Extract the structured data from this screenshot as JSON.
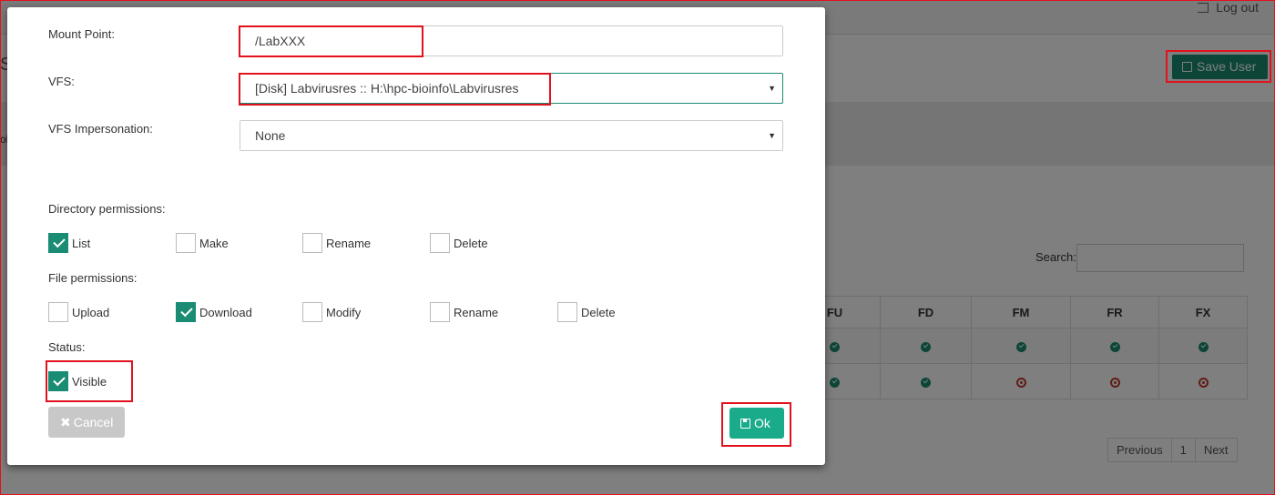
{
  "header": {
    "logout_label": "Log out",
    "save_user_label": "Save User"
  },
  "background": {
    "title_fragment": "S",
    "band_fragment": "ol",
    "search_label": "Search:",
    "table": {
      "columns": [
        "FU",
        "FD",
        "FM",
        "FR",
        "FX"
      ],
      "rows": [
        [
          "ok",
          "ok",
          "ok",
          "ok",
          "ok"
        ],
        [
          "ok",
          "ok",
          "no",
          "no",
          "no"
        ]
      ]
    },
    "pagination": {
      "previous": "Previous",
      "page": "1",
      "next": "Next"
    }
  },
  "modal": {
    "mount_point": {
      "label": "Mount Point:",
      "value": "/LabXXX"
    },
    "vfs": {
      "label": "VFS:",
      "value": "[Disk] Labvirusres :: H:\\hpc-bioinfo\\Labvirusres"
    },
    "vfs_impersonation": {
      "label": "VFS Impersonation:",
      "value": "None"
    },
    "directory_permissions": {
      "label": "Directory permissions:",
      "items": [
        {
          "label": "List",
          "checked": true
        },
        {
          "label": "Make",
          "checked": false
        },
        {
          "label": "Rename",
          "checked": false
        },
        {
          "label": "Delete",
          "checked": false
        }
      ]
    },
    "file_permissions": {
      "label": "File permissions:",
      "items": [
        {
          "label": "Upload",
          "checked": false
        },
        {
          "label": "Download",
          "checked": true
        },
        {
          "label": "Modify",
          "checked": false
        },
        {
          "label": "Rename",
          "checked": false
        },
        {
          "label": "Delete",
          "checked": false
        }
      ]
    },
    "status": {
      "label": "Status:",
      "visible_label": "Visible",
      "visible_checked": true
    },
    "cancel_label": "Cancel",
    "ok_label": "Ok"
  },
  "colors": {
    "accent": "#1a8c73",
    "ok_button": "#1aab8b",
    "highlight": "#e2121c",
    "danger": "#c0392b"
  }
}
